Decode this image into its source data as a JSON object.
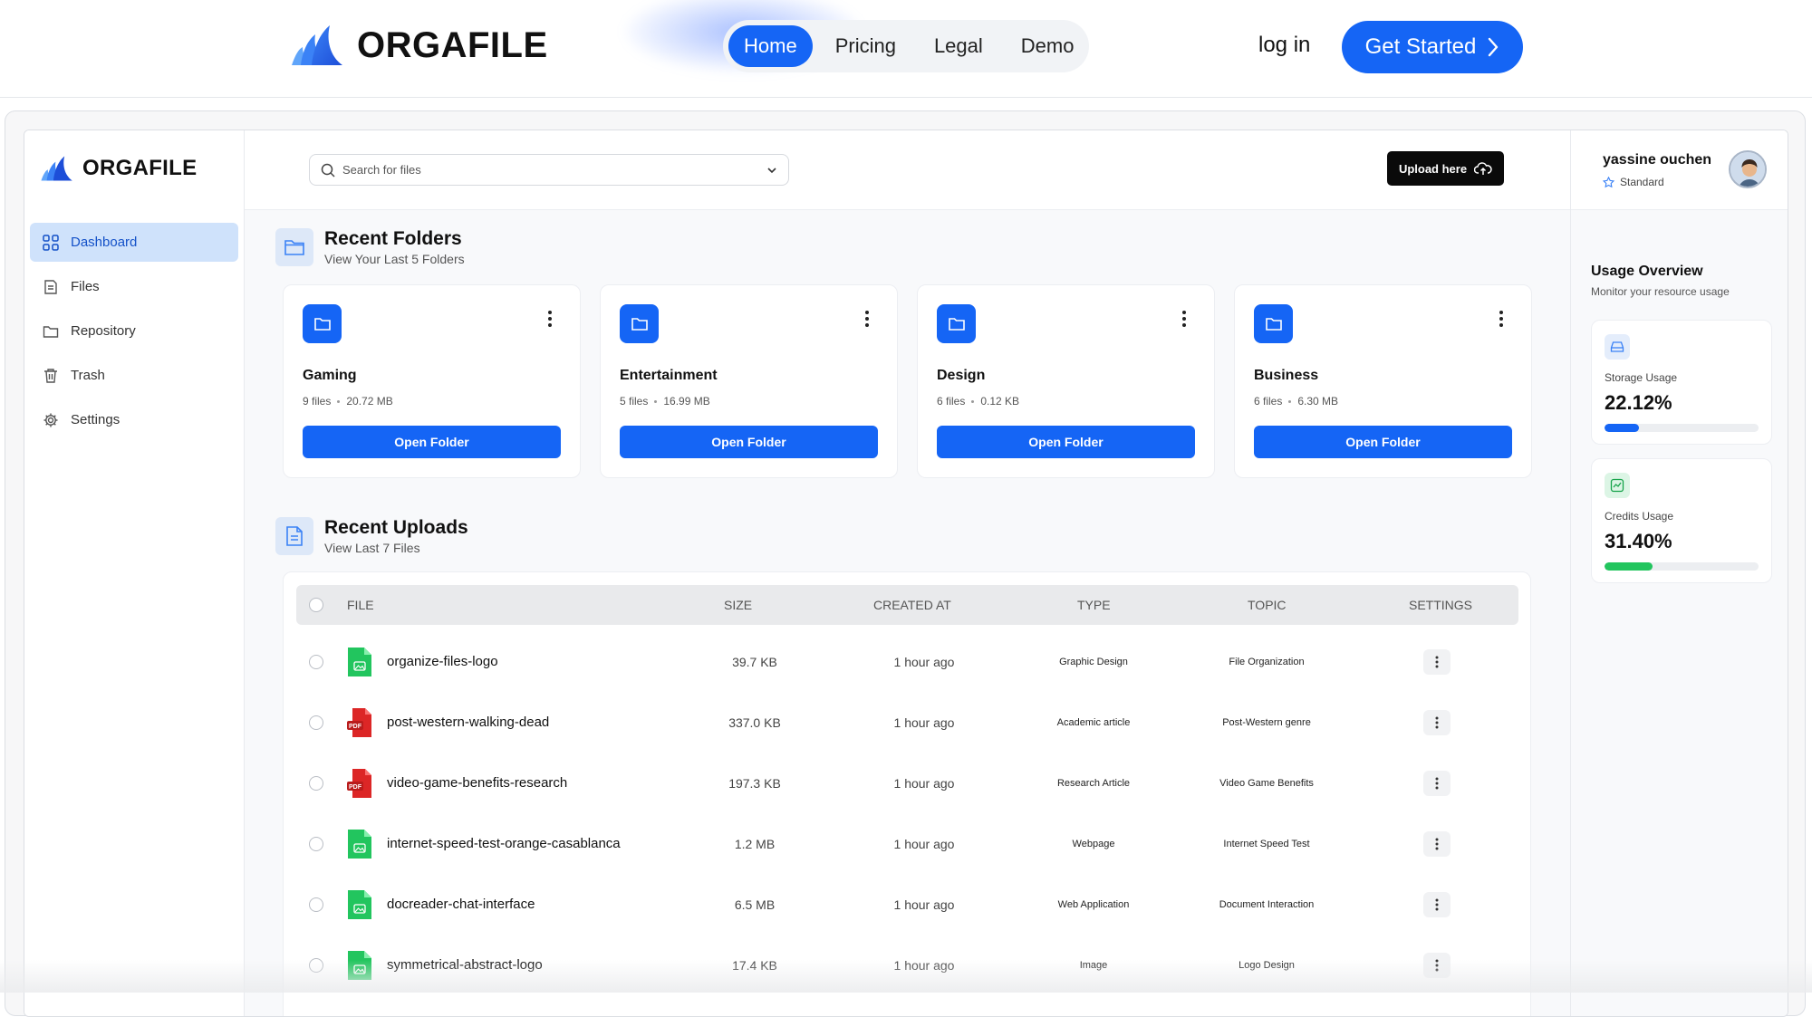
{
  "topnav": {
    "brand": "ORGAFILE",
    "links": [
      "Home",
      "Pricing",
      "Legal",
      "Demo"
    ],
    "active_link": "Home",
    "login": "log in",
    "cta": "Get Started"
  },
  "sidebar": {
    "brand": "ORGAFILE",
    "items": [
      {
        "label": "Dashboard",
        "icon": "grid-icon",
        "active": true
      },
      {
        "label": "Files",
        "icon": "file-icon",
        "active": false
      },
      {
        "label": "Repository",
        "icon": "folder-icon",
        "active": false
      },
      {
        "label": "Trash",
        "icon": "trash-icon",
        "active": false
      },
      {
        "label": "Settings",
        "icon": "gear-icon",
        "active": false
      }
    ]
  },
  "topbar": {
    "search_placeholder": "Search for files",
    "upload_label": "Upload here"
  },
  "recent_folders": {
    "title": "Recent Folders",
    "subtitle": "View Your Last 5 Folders",
    "folders": [
      {
        "name": "Gaming",
        "files": "9 files",
        "size": "20.72 MB",
        "button": "Open Folder"
      },
      {
        "name": "Entertainment",
        "files": "5 files",
        "size": "16.99 MB",
        "button": "Open Folder"
      },
      {
        "name": "Design",
        "files": "6 files",
        "size": "0.12 KB",
        "button": "Open Folder"
      },
      {
        "name": "Business",
        "files": "6 files",
        "size": "6.30 MB",
        "button": "Open Folder"
      }
    ]
  },
  "recent_uploads": {
    "title": "Recent Uploads",
    "subtitle": "View Last 7 Files",
    "columns": [
      "FILE",
      "SIZE",
      "CREATED AT",
      "TYPE",
      "TOPIC",
      "SETTINGS"
    ],
    "rows": [
      {
        "file": "organize-files-logo",
        "kind": "image",
        "size": "39.7 KB",
        "created": "1 hour ago",
        "type": "Graphic Design",
        "topic": "File Organization"
      },
      {
        "file": "post-western-walking-dead",
        "kind": "pdf",
        "size": "337.0 KB",
        "created": "1 hour ago",
        "type": "Academic article",
        "topic": "Post-Western genre"
      },
      {
        "file": "video-game-benefits-research",
        "kind": "pdf",
        "size": "197.3 KB",
        "created": "1 hour ago",
        "type": "Research Article",
        "topic": "Video Game Benefits"
      },
      {
        "file": "internet-speed-test-orange-casablanca",
        "kind": "image",
        "size": "1.2 MB",
        "created": "1 hour ago",
        "type": "Webpage",
        "topic": "Internet Speed Test"
      },
      {
        "file": "docreader-chat-interface",
        "kind": "image",
        "size": "6.5 MB",
        "created": "1 hour ago",
        "type": "Web Application",
        "topic": "Document Interaction"
      },
      {
        "file": "symmetrical-abstract-logo",
        "kind": "image",
        "size": "17.4 KB",
        "created": "1 hour ago",
        "type": "Image",
        "topic": "Logo Design"
      }
    ],
    "pdf_badge": "PDF"
  },
  "user": {
    "name": "yassine ouchen",
    "plan": "Standard"
  },
  "usage": {
    "title": "Usage Overview",
    "subtitle": "Monitor your resource usage",
    "storage": {
      "label": "Storage Usage",
      "value": "22.12%",
      "fraction": 0.2212,
      "color": "#1565f5"
    },
    "credits": {
      "label": "Credits Usage",
      "value": "31.40%",
      "fraction": 0.314,
      "color": "#22c55e"
    }
  }
}
